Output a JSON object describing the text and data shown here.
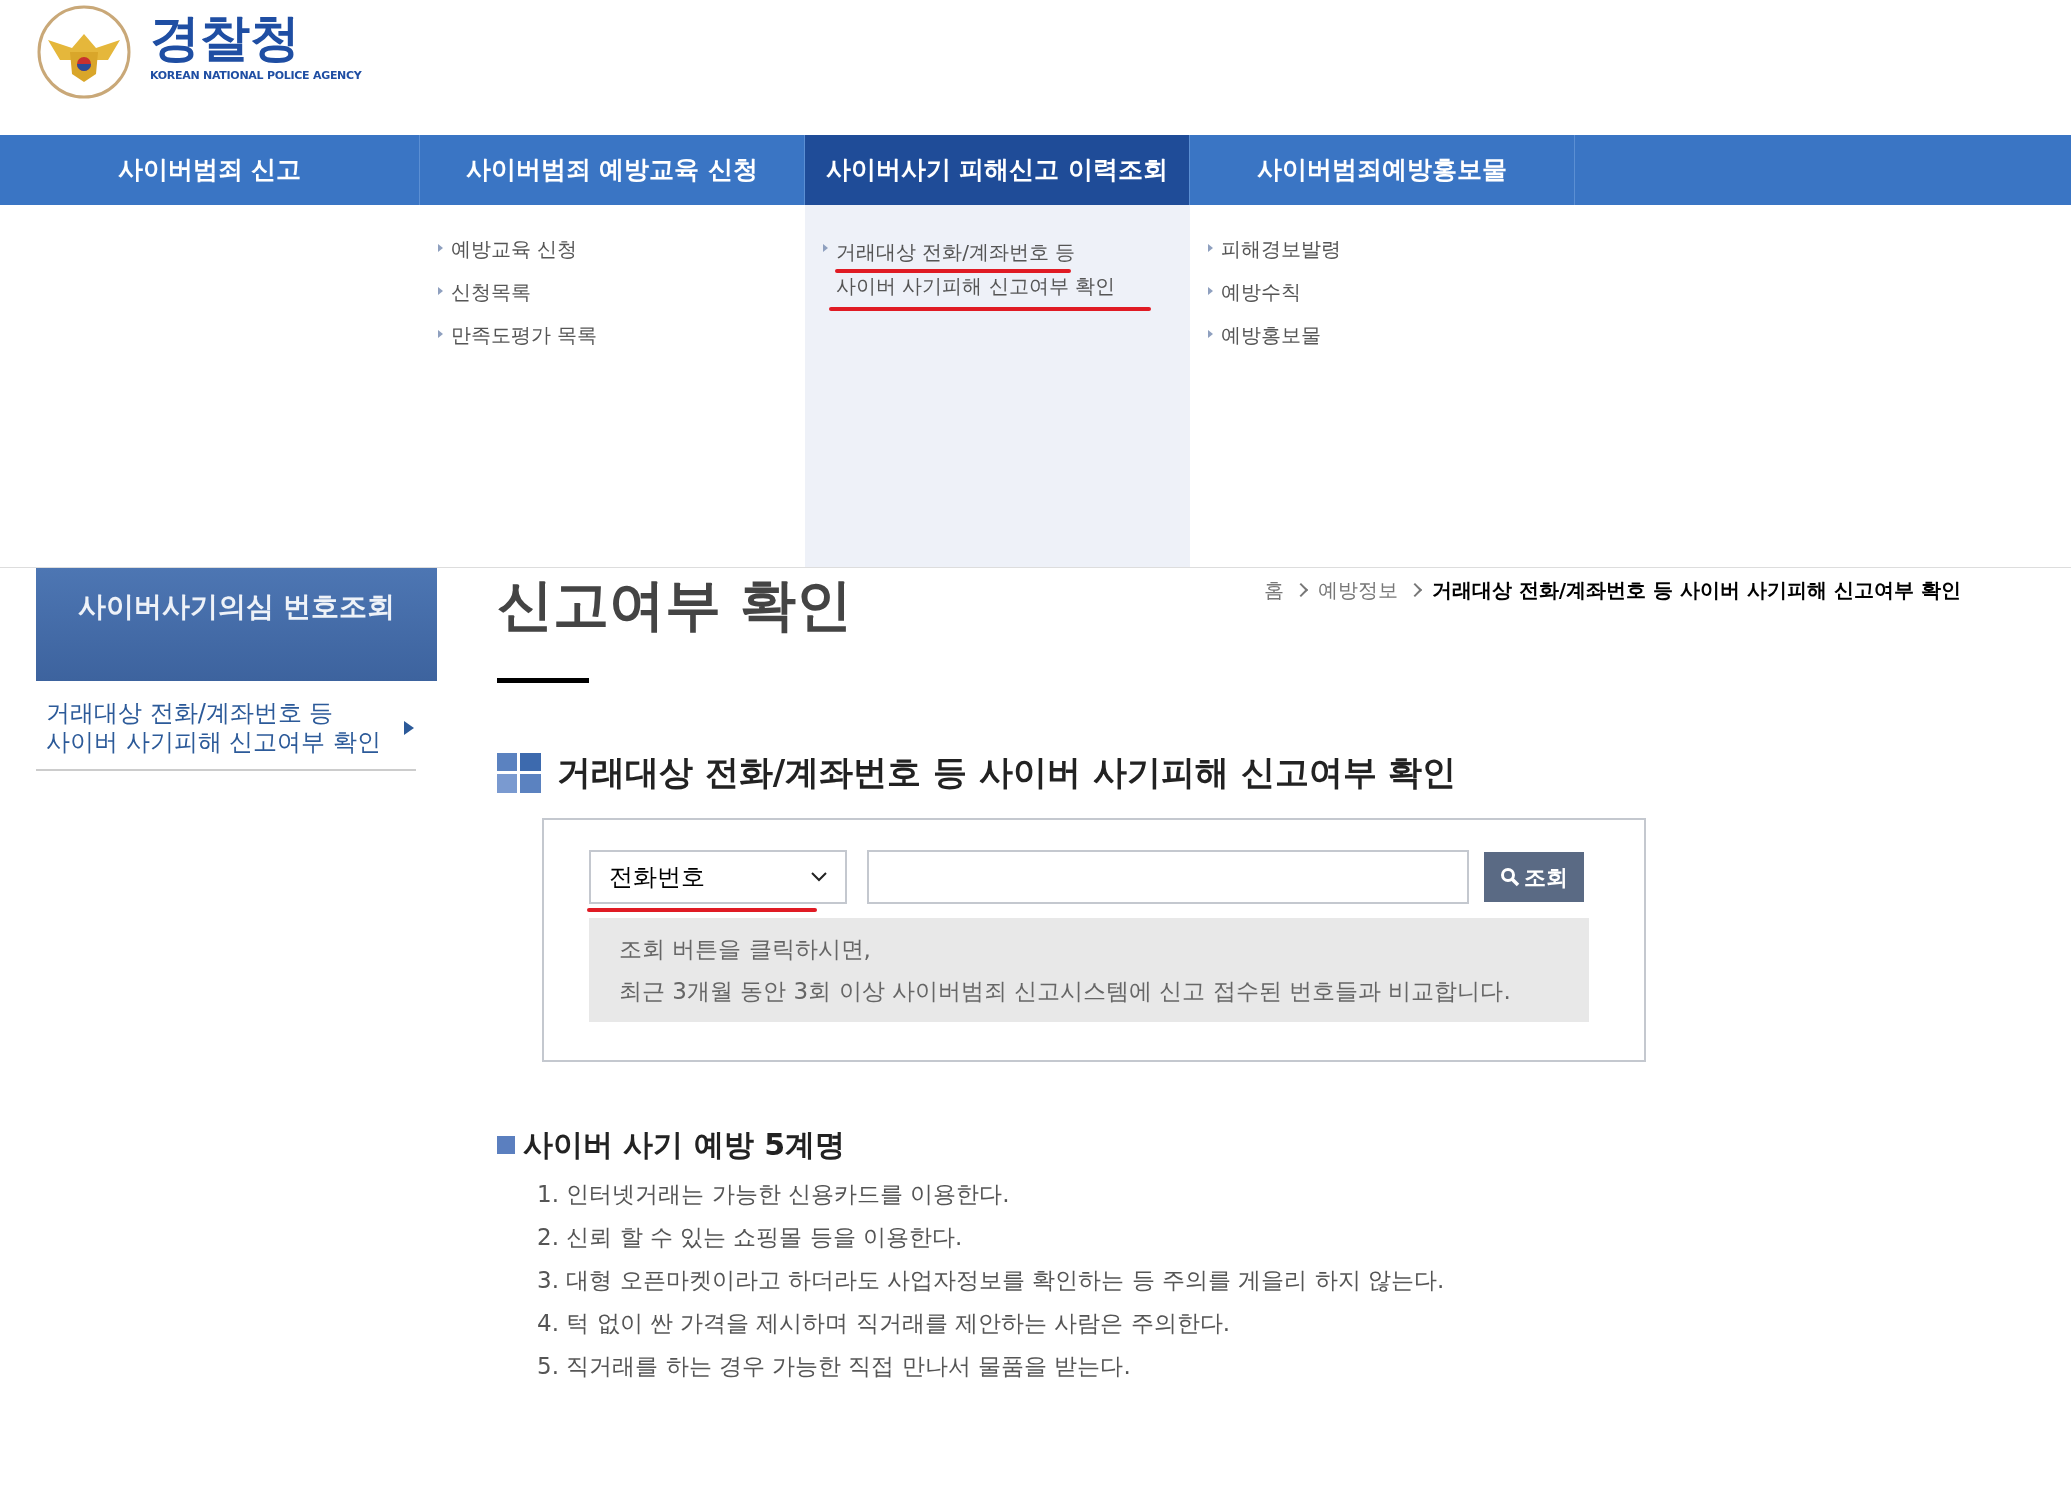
{
  "header": {
    "logo_title": "경찰청",
    "logo_subtitle": "KOREAN NATIONAL POLICE AGENCY"
  },
  "nav": {
    "tabs": [
      {
        "label": "사이버범죄 신고",
        "selected": false
      },
      {
        "label": "사이버범죄 예방교육 신청",
        "selected": false,
        "links": [
          "예방교육 신청",
          "신청목록",
          "만족도평가 목록"
        ]
      },
      {
        "label": "사이버사기 피해신고 이력조회",
        "selected": true,
        "links": [
          "거래대상 전화/계좌번호 등 사이버 사기피해 신고여부 확인"
        ]
      },
      {
        "label": "사이버범죄예방홍보물",
        "selected": false,
        "links": [
          "피해경보발령",
          "예방수칙",
          "예방홍보물"
        ]
      }
    ]
  },
  "sidebar": {
    "title": "사이버사기의심 번호조회",
    "items": [
      {
        "label": "거래대상 전화/계좌번호 등 사이버 사기피해 신고여부 확인",
        "selected": true
      }
    ]
  },
  "page": {
    "title": "신고여부 확인",
    "breadcrumb": [
      {
        "label": "홈",
        "current": false
      },
      {
        "label": "예방정보",
        "current": false
      },
      {
        "label": "거래대상 전화/계좌번호 등 사이버 사기피해 신고여부 확인",
        "current": true
      }
    ],
    "section_title": "거래대상 전화/계좌번호 등 사이버 사기피해 신고여부 확인",
    "search": {
      "type_value": "전화번호",
      "button": "조회",
      "notice": [
        "조회 버튼을 클릭하시면,",
        "최근 3개월 동안 3회 이상 사이버범죄 신고시스템에 신고 접수된 번호들과 비교합니다."
      ]
    },
    "tips": {
      "title": "사이버 사기 예방 5계명",
      "items": [
        "1. 인터넷거래는 가능한 신용카드를 이용한다.",
        "2. 신뢰 할 수 있는 쇼핑몰 등을 이용한다.",
        "3. 대형 오픈마켓이라고 하더라도 사업자정보를 확인하는 등 주의를 게을리 하지 않는다.",
        "4. 턱 없이 싼 가격을 제시하며 직거래를 제안하는 사람은 주의한다.",
        "5. 직거래를 하는 경우 가능한 직접 만나서 물품을 받는다."
      ]
    }
  }
}
